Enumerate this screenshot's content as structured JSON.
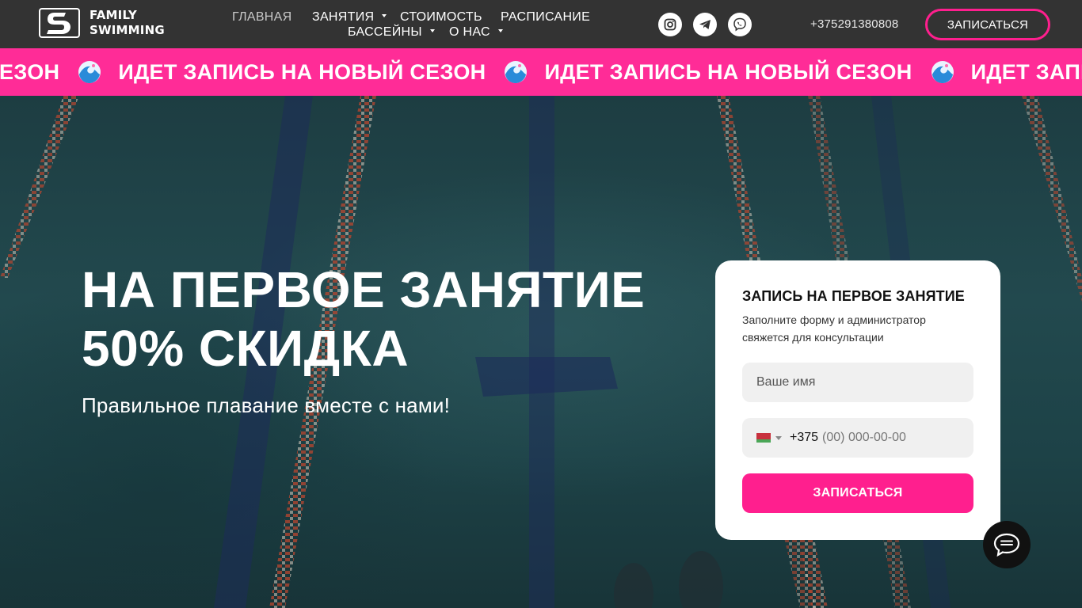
{
  "brand": {
    "line1": "FAMILY",
    "line2": "SWIMMING"
  },
  "nav": {
    "home": "ГЛАВНАЯ",
    "classes": "ЗАНЯТИЯ",
    "price": "СТОИМОСТЬ",
    "schedule": "РАСПИСАНИЕ",
    "pools": "БАССЕЙНЫ",
    "about": "О НАС"
  },
  "social": [
    "instagram-icon",
    "telegram-icon",
    "viber-icon"
  ],
  "header": {
    "phone": "+375291380808",
    "cta": "ЗАПИСАТЬСЯ"
  },
  "ticker": {
    "first": "ЫЙ СЕЗОН",
    "item": "ИДЕТ ЗАПИСЬ НА НОВЫЙ СЕЗОН",
    "last": "ИДЕТ ЗАПИСЬ"
  },
  "hero": {
    "title_line1": "НА ПЕРВОЕ ЗАНЯТИЕ",
    "title_line2": "50% СКИДКА",
    "subtitle": "Правильное плавание вместе с нами!"
  },
  "form": {
    "title": "ЗАПИСЬ НА ПЕРВОЕ ЗАНЯТИЕ",
    "description": "Заполните форму и администратор свяжется для консультации",
    "name_placeholder": "Ваше имя",
    "phone_code": "+375",
    "phone_mask": "(00) 000-00-00",
    "submit": "ЗАПИСАТЬСЯ"
  },
  "colors": {
    "accent": "#ff1f8e",
    "header_bg": "#333333",
    "ticker_bg": "#ff2c97"
  }
}
